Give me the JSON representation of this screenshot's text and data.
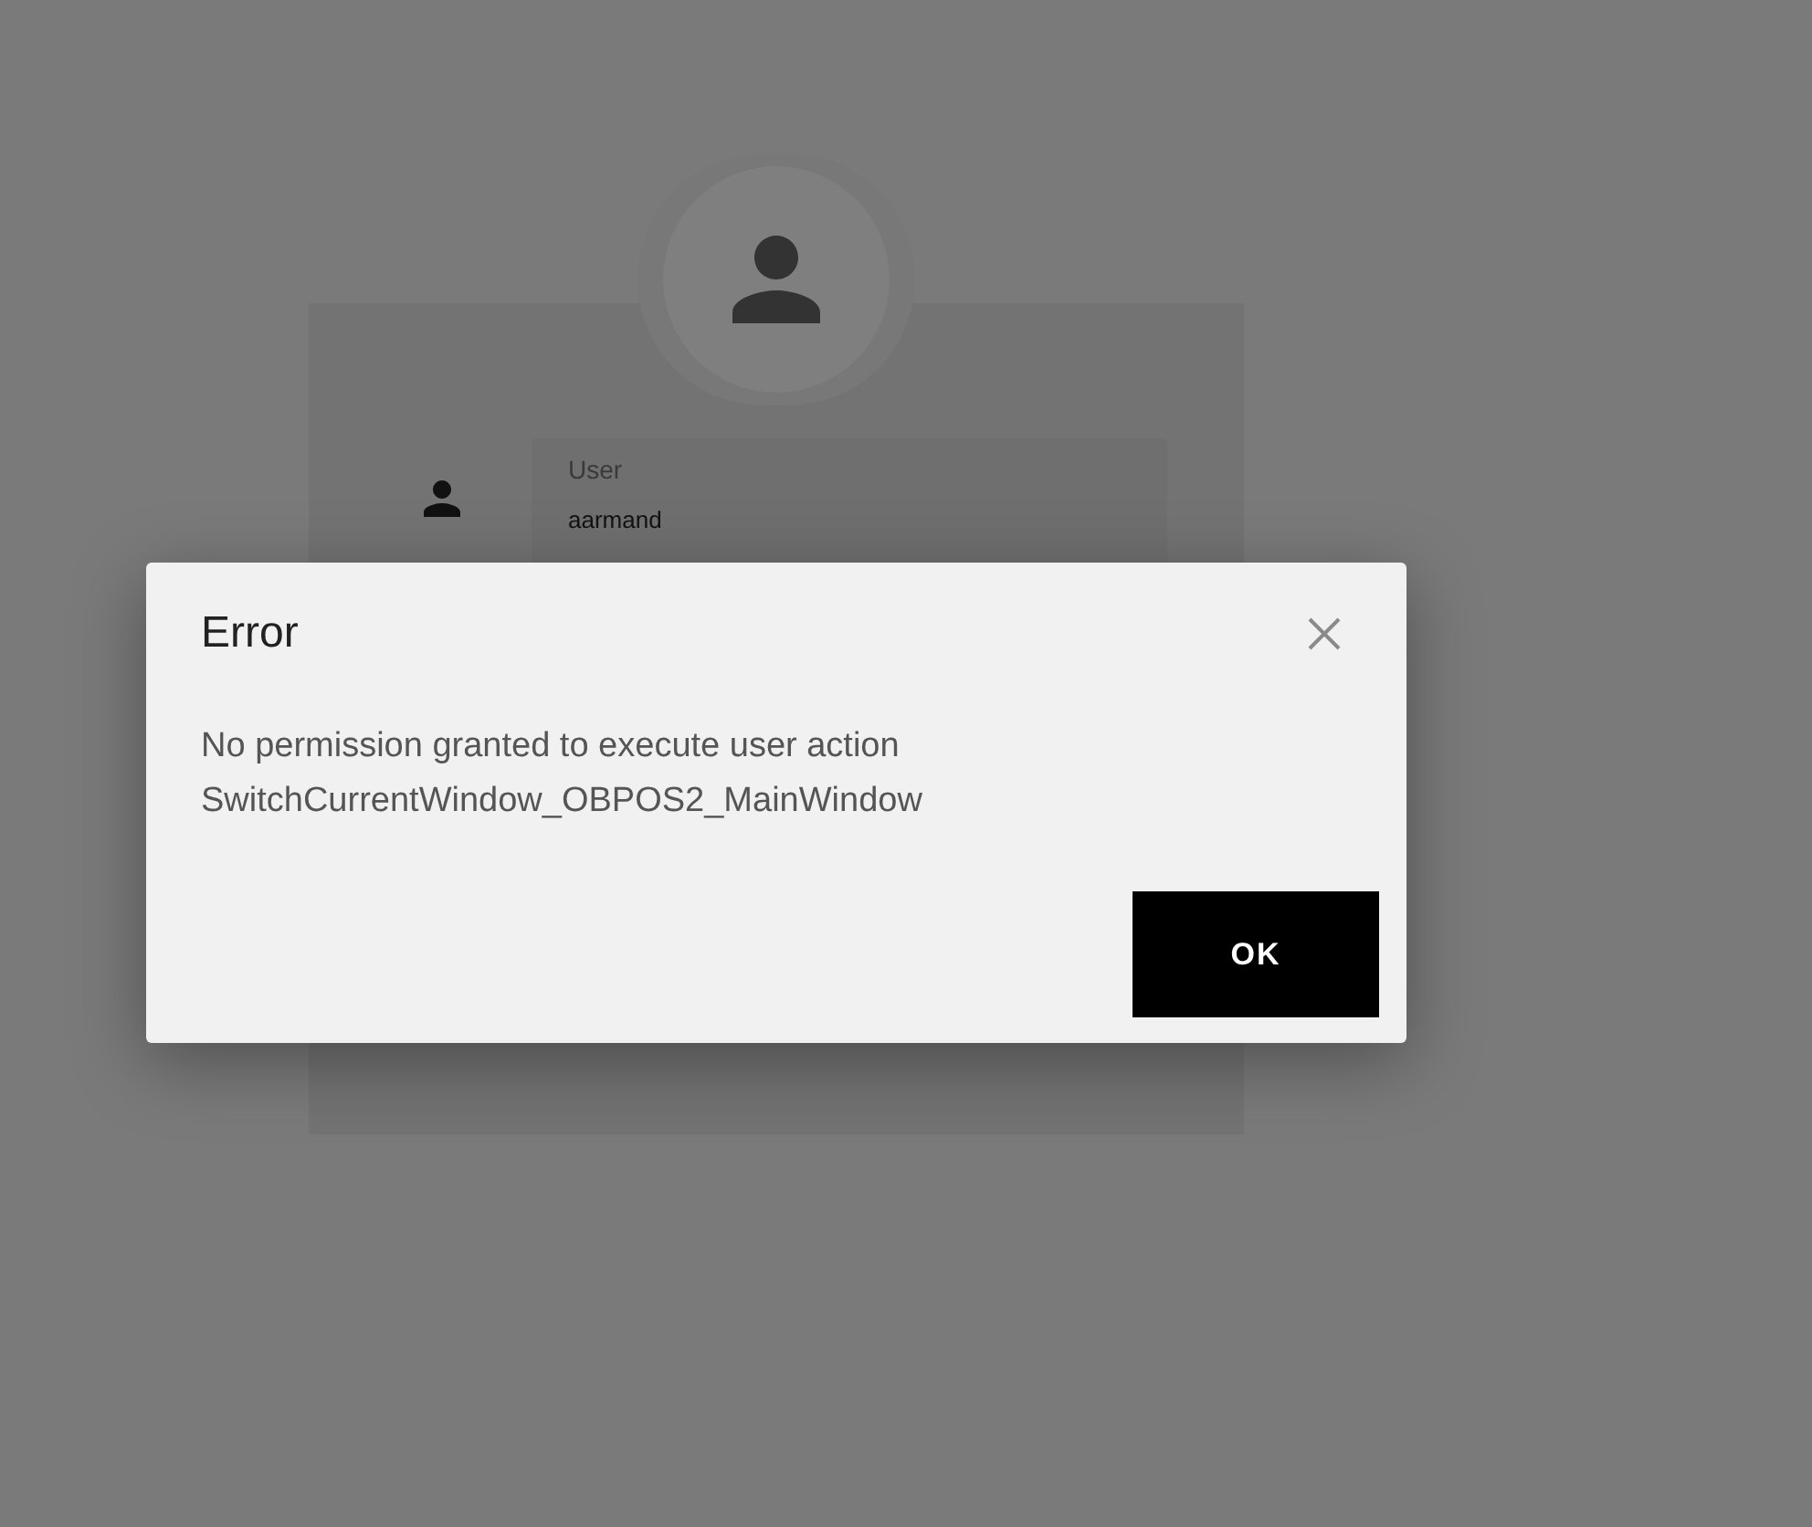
{
  "login": {
    "user_field": {
      "label": "User",
      "value": "aarmand"
    }
  },
  "dialog": {
    "title": "Error",
    "message": [
      "No permission granted to execute user action",
      "SwitchCurrentWindow_OBPOS2_MainWindow"
    ],
    "buttons": [
      "OK"
    ]
  }
}
